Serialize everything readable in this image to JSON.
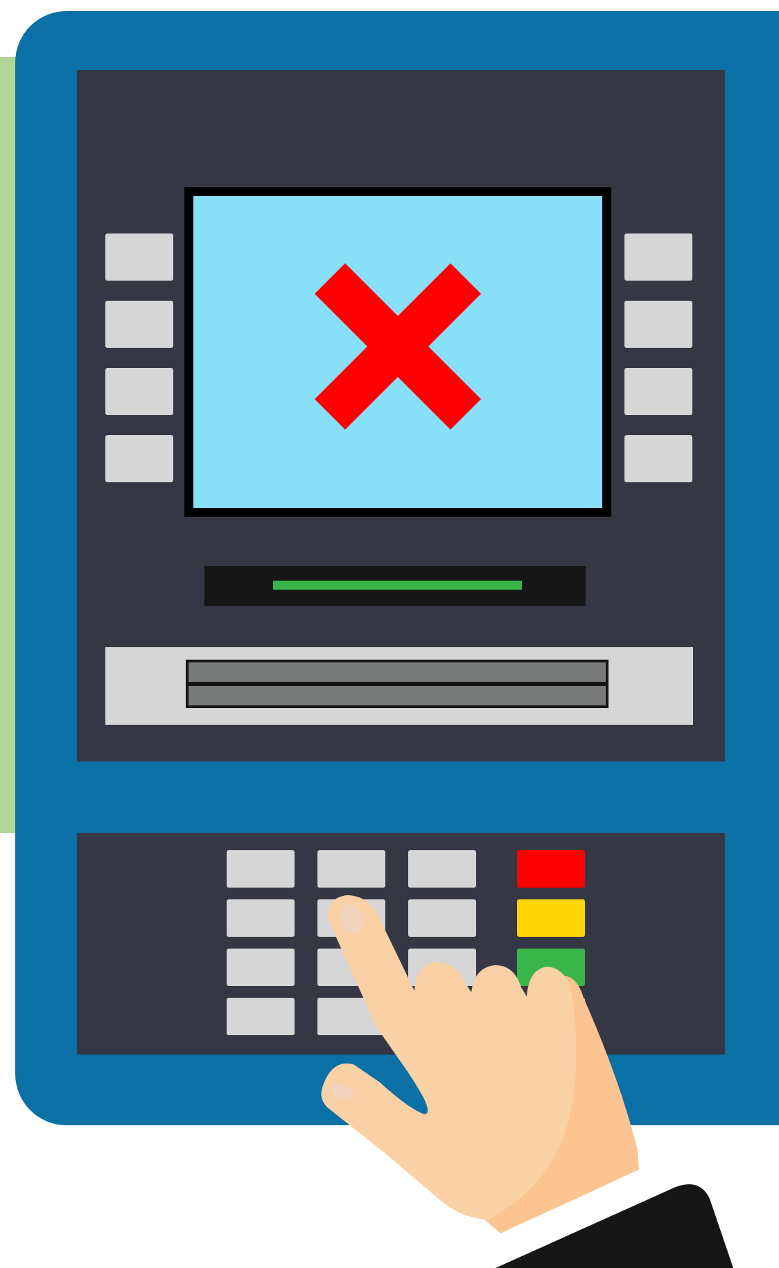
{
  "device": "atm",
  "screen": {
    "status_icon": "error-x-icon",
    "background_color": "#88dff8",
    "icon_color": "#ff0000"
  },
  "colors": {
    "atm_body": "#0a70a6",
    "panel": "#353844",
    "button": "#d6d6d6",
    "receipt_light": "#3ab54a"
  },
  "side_buttons": {
    "left_count": 4,
    "right_count": 4
  },
  "keypad": {
    "rows": 4,
    "columns": 3,
    "function_keys": [
      {
        "name": "cancel",
        "color": "#ff0000"
      },
      {
        "name": "clear",
        "color": "#ffd400"
      },
      {
        "name": "enter",
        "color": "#3ab54a"
      }
    ]
  },
  "hand": {
    "icon": "pointing-hand-icon",
    "skin_color": "#fad0a5",
    "sleeve_color": "#161616"
  }
}
